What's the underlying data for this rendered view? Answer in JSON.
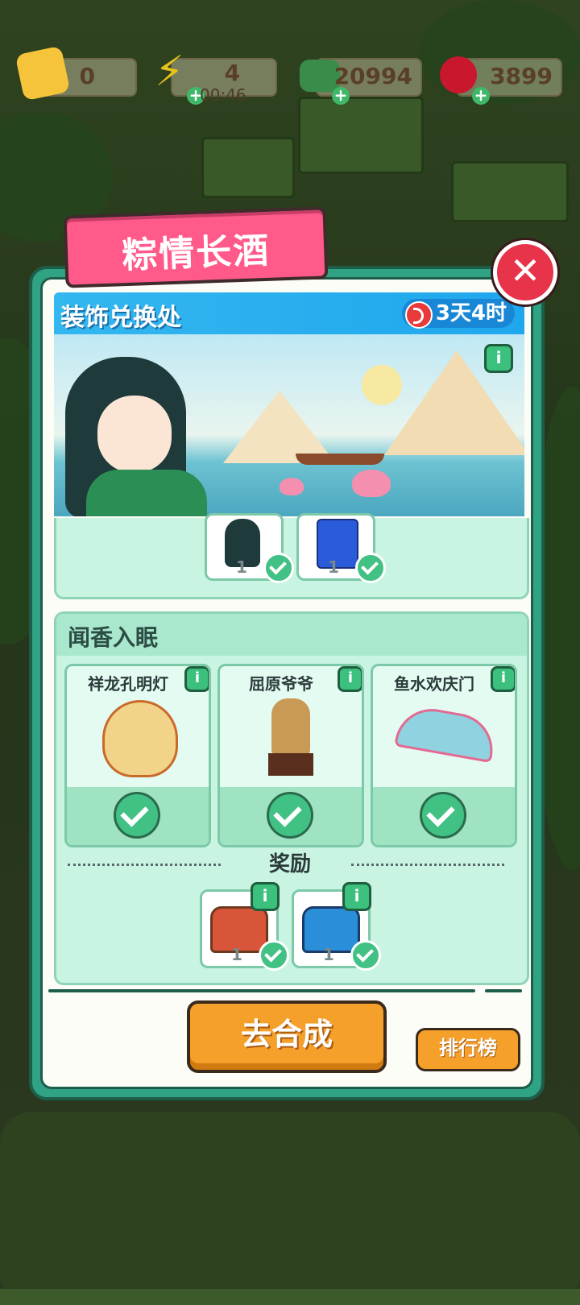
{
  "top_bar": {
    "tickets": {
      "value": "0",
      "icon": "ticket-icon"
    },
    "energy": {
      "value": "4",
      "timer": "00:46",
      "icon": "lightning-icon"
    },
    "cash": {
      "value": "20994",
      "icon": "cash-icon"
    },
    "gems": {
      "value": "3899",
      "icon": "ruby-icon"
    }
  },
  "event": {
    "title": "粽情长酒",
    "shop_title": "装饰兑换处",
    "timer": "3天4时"
  },
  "top_rewards": [
    {
      "qty": "1",
      "icon": "character-icon"
    },
    {
      "qty": "1",
      "icon": "upgrade-card-icon"
    }
  ],
  "section": {
    "title": "闻香入眠",
    "items": [
      {
        "name": "祥龙孔明灯",
        "icon": "dragon-lantern-icon"
      },
      {
        "name": "屈原爷爷",
        "icon": "statue-icon"
      },
      {
        "name": "鱼水欢庆门",
        "icon": "wave-gate-icon"
      }
    ],
    "reward_label": "奖励",
    "rewards": [
      {
        "qty": "1",
        "icon": "red-chest-icon"
      },
      {
        "qty": "1",
        "icon": "blue-chest-icon"
      }
    ]
  },
  "buttons": {
    "go": "去合成",
    "rank": "排行榜",
    "close": "✕",
    "info": "i"
  },
  "colors": {
    "panel": "#2fa383",
    "ribbon": "#ff5a8a",
    "banner": "#1fa7ee",
    "button": "#f5a02a"
  }
}
